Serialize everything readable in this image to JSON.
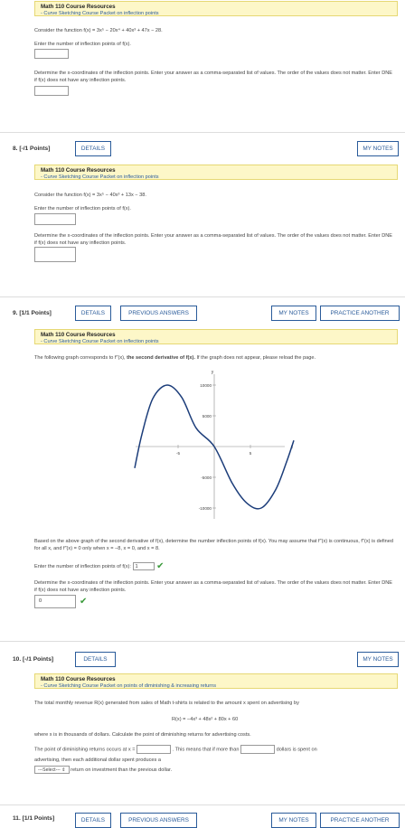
{
  "q7": {
    "res_title": "Math 110 Course Resources",
    "res_sub": "- Curve Sketching Course Packet on inflection points",
    "consider": "Consider the function f(x) = 3x⁵ − 20x⁴ + 40x³ + 47x − 28.",
    "enter_num": "Enter the number of inflection points of f(x).",
    "determine": "Determine the x-coordinates of the inflection points. Enter your answer as a comma-separated list of values. The order of the values does not matter. Enter DNE if f(x) does not have any inflection points."
  },
  "q8": {
    "num": "8.  [-/1 Points]",
    "details": "DETAILS",
    "my_notes": "MY NOTES",
    "res_title": "Math 110 Course Resources",
    "res_sub": "- Curve Sketching Course Packet on inflection points",
    "consider": "Consider the function f(x) = 3x⁵ − 40x³ + 13x − 38.",
    "enter_num": "Enter the number of inflection points of f(x).",
    "determine": "Determine the x-coordinates of the inflection points. Enter your answer as a comma-separated list of values. The order of the values does not matter. Enter DNE if f(x) does not have any inflection points."
  },
  "q9": {
    "num": "9.  [1/1 Points]",
    "details": "DETAILS",
    "prev_answers": "PREVIOUS ANSWERS",
    "my_notes": "MY NOTES",
    "practice": "PRACTICE ANOTHER",
    "res_title": "Math 110 Course Resources",
    "res_sub": "- Curve Sketching Course Packet on inflection points",
    "intro_a": "The following graph corresponds to f″(x), ",
    "intro_b": "the second derivative of f(x).",
    "intro_c": " If the graph does not appear, please reload the page.",
    "graph": {
      "y_axis": "y",
      "x_axis": "x",
      "ticks_y": [
        "10000",
        "5000",
        "-5000",
        "-10000"
      ],
      "ticks_x": [
        "-5",
        "5"
      ]
    },
    "based_on": "Based on the above graph of the second derivative of f(x), determine the number inflection points of f(x). You may assume that f″(x) is continuous, f″(x) is defined for all x, and f″(x) = 0 only when x = −8, x = 0, and x = 8.",
    "enter_num": "Enter the number of inflection points of f(x):",
    "enter_num_value": "1",
    "determine": "Determine the x-coordinates of the inflection points. Enter your answer as a comma-separated list of values. The order of the values does not matter. Enter DNE if f(x) does not have any inflection points.",
    "answer_value": "0"
  },
  "q10": {
    "num": "10.  [-/1 Points]",
    "details": "DETAILS",
    "my_notes": "MY NOTES",
    "res_title": "Math 110 Course Resources",
    "res_sub": "- Curve Sketching Course Packet on points of diminishing & increasing returns",
    "revenue": "The total monthly revenue R(x) generated from sales of Math t-shirts is related to the amount x spent on advertising by",
    "formula": "R(x) = −4x³ + 48x² + 80x + 60",
    "where": "where x is in thousands of dollars. Calculate the point of diminishing returns for advertising costs.",
    "point_a": "The point of diminishing returns occurs at x =",
    "point_b": ". This means that if more than",
    "point_c": "dollars is spent on",
    "advert": "advertising, then each additional dollar spent produces a",
    "select_label": "---Select--- ⇕",
    "return_text": "return on investment than the previous dollar."
  },
  "q11": {
    "num": "11.  [1/1 Points]",
    "details": "DETAILS",
    "prev_answers": "PREVIOUS ANSWERS",
    "my_notes": "MY NOTES",
    "practice": "PRACTICE ANOTHER"
  },
  "colors": {
    "link": "#2a5b9a",
    "resource_bg": "#fdf7c8",
    "check": "#3a9a3a"
  },
  "curve": {
    "comment": "second derivative curve, in graph data units",
    "points": [
      [
        -11,
        -3500
      ],
      [
        -10,
        2000
      ],
      [
        -8.5,
        7800
      ],
      [
        -6.5,
        10000
      ],
      [
        -4.5,
        8000
      ],
      [
        -2.5,
        3000
      ],
      [
        0,
        0
      ],
      [
        2.5,
        -6000
      ],
      [
        4.5,
        -9200
      ],
      [
        6.5,
        -10000
      ],
      [
        8.5,
        -7000
      ],
      [
        10,
        -2500
      ],
      [
        11,
        1000
      ]
    ]
  }
}
